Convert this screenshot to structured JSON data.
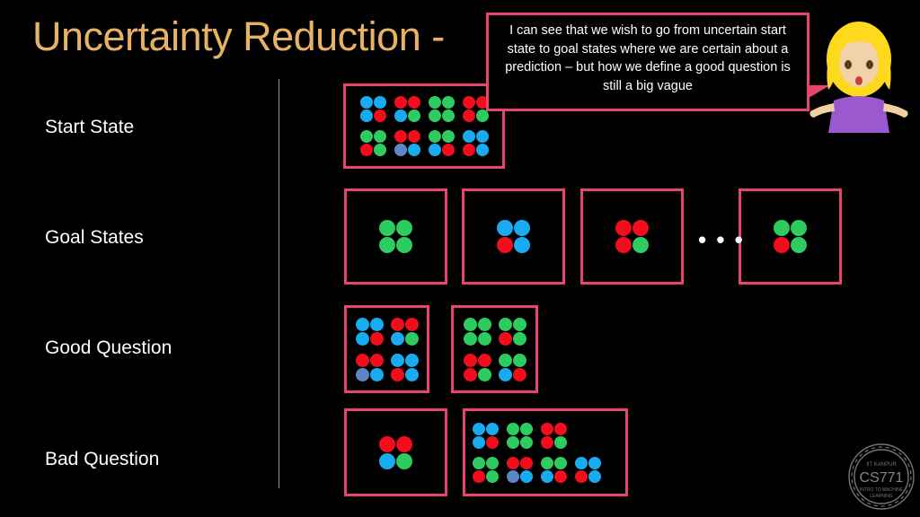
{
  "slide": {
    "title": "Uncertainty Reduction -",
    "background_color": "#000000",
    "title_color": "#e8b265",
    "box_border_color": "#e8456e"
  },
  "colors": {
    "red": "#f20d1c",
    "green": "#2ecc60",
    "blue": "#19aaf0",
    "muted_blue": "#5b87c8"
  },
  "rows": [
    {
      "label": "Start State"
    },
    {
      "label": "Goal States"
    },
    {
      "label": "Good Question"
    },
    {
      "label": "Bad Question"
    }
  ],
  "ellipsis": "• • •",
  "bubble": {
    "text": "I can see that we wish to go from uncertain start state to goal states where we are certain about a prediction – but how we define a good question is still a big vague"
  },
  "logo": {
    "line1": "IIT KANPUR",
    "line2": "CS771",
    "line3": "INTRO TO MACHINE",
    "line4": "LEARNING"
  },
  "character": {
    "name": "woman-shrugging-emoji",
    "hair_color": "#ffd91e",
    "skin_color": "#f0cfa0",
    "shirt_color": "#9b59d0"
  },
  "chart_data": {
    "type": "table",
    "title": "Uncertainty Reduction - grouped dot states",
    "note": "Each box contains groups of 4 dots (2x2 quads). Colors: r=red, g=green, b=blue, m=muted blue.",
    "start_state": {
      "rows": [
        [
          [
            "b",
            "b",
            "b",
            "r"
          ],
          [
            "r",
            "r",
            "b",
            "g"
          ],
          [
            "g",
            "g",
            "g",
            "g"
          ],
          [
            "r",
            "r",
            "r",
            "g"
          ]
        ],
        [
          [
            "g",
            "g",
            "r",
            "g"
          ],
          [
            "r",
            "r",
            "m",
            "b"
          ],
          [
            "g",
            "g",
            "b",
            "r"
          ],
          [
            "b",
            "b",
            "r",
            "b"
          ]
        ]
      ]
    },
    "goal_states": [
      {
        "quad": [
          "g",
          "g",
          "g",
          "g"
        ]
      },
      {
        "quad": [
          "b",
          "b",
          "r",
          "b"
        ]
      },
      {
        "quad": [
          "r",
          "r",
          "r",
          "g"
        ]
      },
      {
        "quad": [
          "g",
          "g",
          "r",
          "g"
        ]
      }
    ],
    "good_question": [
      {
        "rows": [
          [
            [
              "b",
              "b",
              "b",
              "r"
            ],
            [
              "r",
              "r",
              "b",
              "g"
            ]
          ],
          [
            [
              "r",
              "r",
              "m",
              "b"
            ],
            [
              "b",
              "b",
              "r",
              "b"
            ]
          ]
        ]
      },
      {
        "rows": [
          [
            [
              "g",
              "g",
              "g",
              "g"
            ],
            [
              "g",
              "g",
              "r",
              "g"
            ]
          ],
          [
            [
              "r",
              "r",
              "r",
              "g"
            ],
            [
              "g",
              "g",
              "b",
              "r"
            ]
          ]
        ]
      }
    ],
    "bad_question": [
      {
        "rows": [
          [
            [
              "r",
              "r",
              "b",
              "g"
            ]
          ]
        ]
      },
      {
        "rows": [
          [
            [
              "b",
              "b",
              "b",
              "r"
            ],
            [
              "g",
              "g",
              "g",
              "g"
            ],
            [
              "r",
              "r",
              "r",
              "g"
            ]
          ],
          [
            [
              "g",
              "g",
              "r",
              "g"
            ],
            [
              "r",
              "r",
              "m",
              "b"
            ],
            [
              "g",
              "g",
              "b",
              "r"
            ],
            [
              "b",
              "b",
              "r",
              "b"
            ]
          ]
        ]
      }
    ]
  }
}
